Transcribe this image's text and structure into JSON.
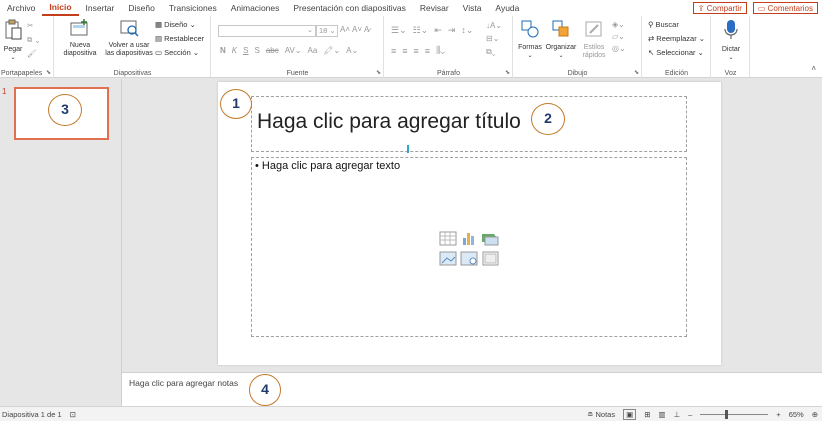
{
  "tabs": [
    "Archivo",
    "Inicio",
    "Insertar",
    "Diseño",
    "Transiciones",
    "Animaciones",
    "Presentación con diapositivas",
    "Revisar",
    "Vista",
    "Ayuda"
  ],
  "active_tab": "Inicio",
  "share_label": "Compartir",
  "comments_label": "Comentarios",
  "ribbon": {
    "portapapeles": {
      "label": "Portapapeles",
      "paste": "Pegar"
    },
    "diapositivas": {
      "label": "Diapositivas",
      "new_line1": "Nueva",
      "new_line2": "diapositiva",
      "reuse_line1": "Volver a usar",
      "reuse_line2": "las diapositivas",
      "layout": "Diseño",
      "reset": "Restablecer",
      "section": "Sección"
    },
    "fuente": {
      "label": "Fuente",
      "font_size": "18",
      "bold": "N",
      "italic": "K",
      "underline": "S",
      "shadow": "S",
      "strike": "abc",
      "aa": "Aa"
    },
    "parrafo": {
      "label": "Párrafo"
    },
    "dibujo": {
      "label": "Dibujo",
      "shapes": "Formas",
      "arrange": "Organizar",
      "styles_line1": "Estilos",
      "styles_line2": "rápidos"
    },
    "edicion": {
      "label": "Edición",
      "find": "Buscar",
      "replace": "Reemplazar",
      "select": "Seleccionar"
    },
    "voz": {
      "label": "Voz",
      "dictate": "Dictar"
    }
  },
  "thumbnail_number": "1",
  "slide": {
    "title_placeholder": "Haga clic para agregar título",
    "body_placeholder": "• Haga clic para agregar texto"
  },
  "notes_placeholder": "Haga clic para agregar notas",
  "status": {
    "slide_info": "Diapositiva 1 de 1",
    "notes_button": "Notas",
    "zoom": "65%",
    "zoom_fraction": 0.36
  },
  "callouts": [
    "1",
    "2",
    "3",
    "4"
  ],
  "colors": {
    "accent": "#c43e1c",
    "callout_border": "#c47a2c",
    "callout_text": "#1f3b6e"
  }
}
